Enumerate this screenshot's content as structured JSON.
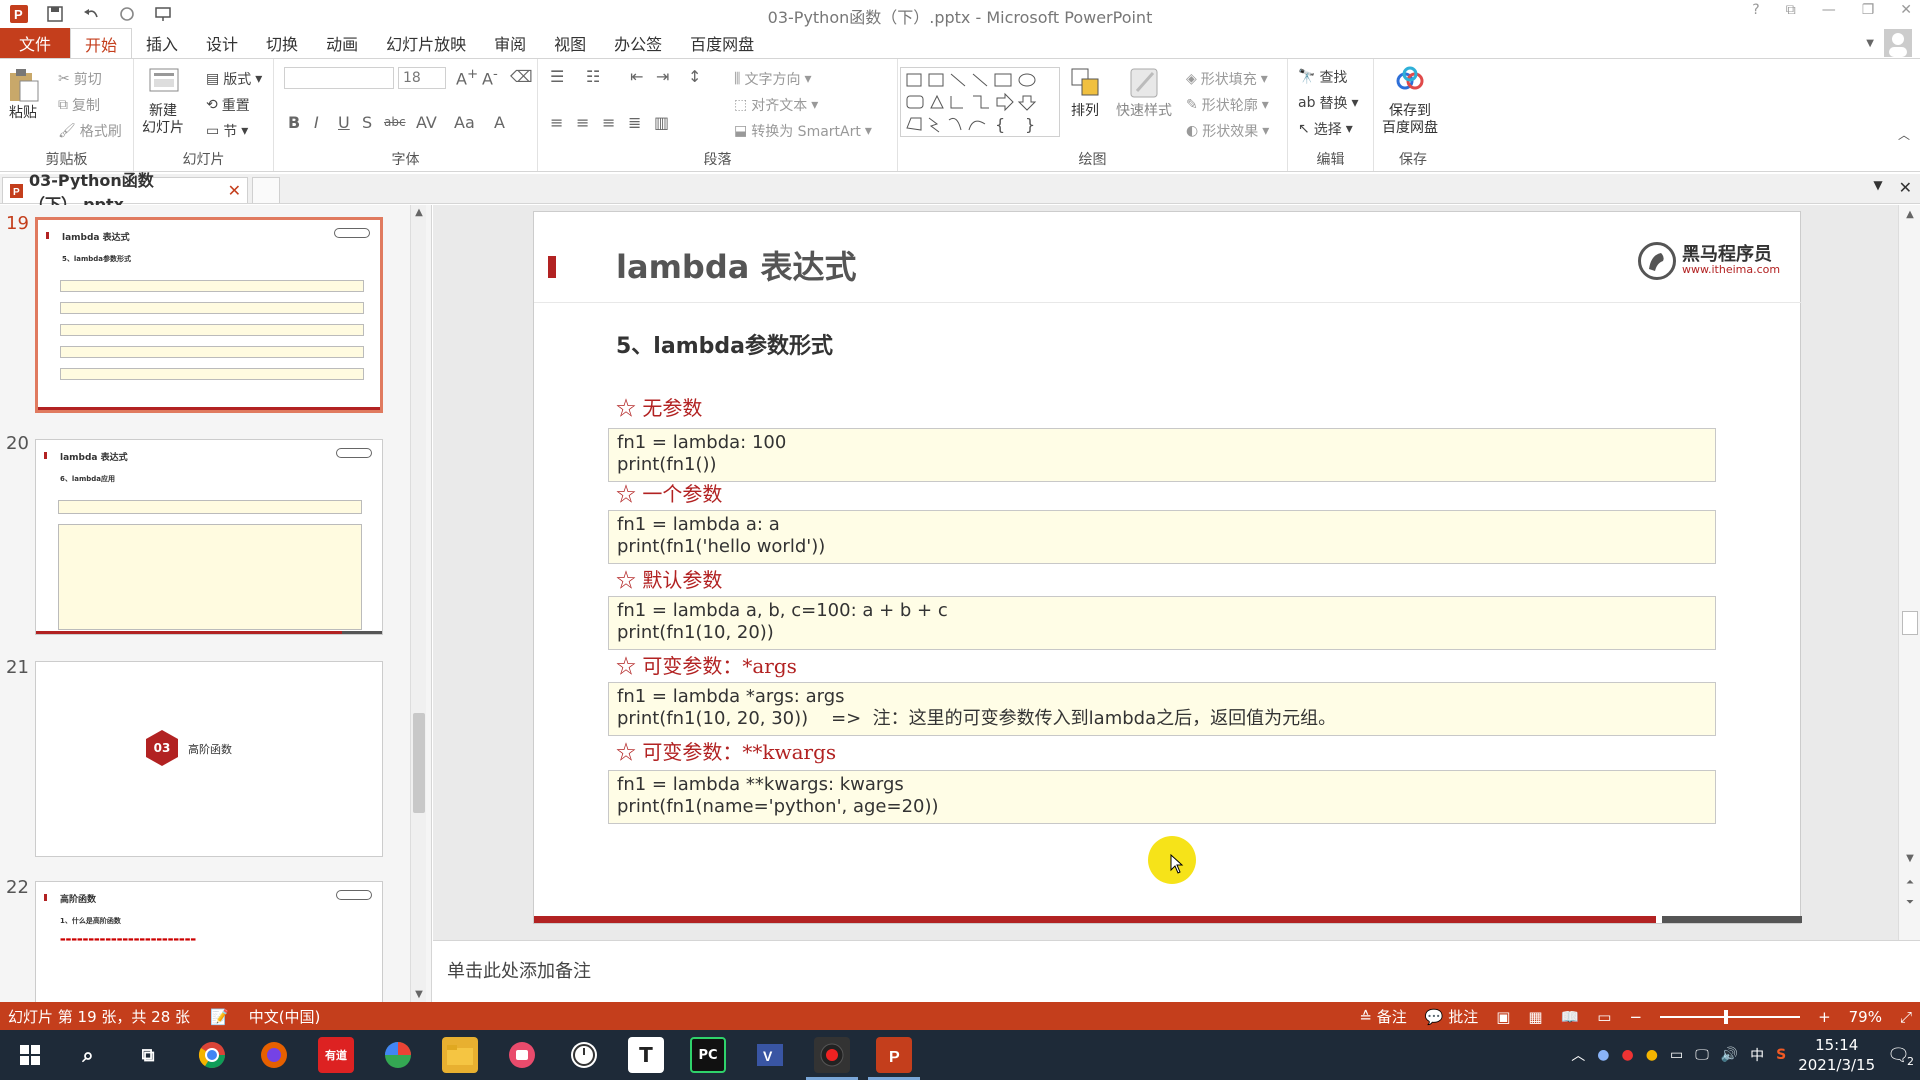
{
  "window": {
    "title": "03-Python函数（下）.pptx - Microsoft PowerPoint",
    "controls": [
      "?",
      "⧉",
      "—",
      "❐",
      "✕"
    ]
  },
  "ribbon_tabs": [
    "文件",
    "开始",
    "插入",
    "设计",
    "切换",
    "动画",
    "幻灯片放映",
    "审阅",
    "视图",
    "办公签",
    "百度网盘"
  ],
  "ribbon": {
    "clipboard": {
      "paste": "粘贴",
      "cut": "剪切",
      "copy": "复制",
      "format_painter": "格式刷",
      "label": "剪贴板"
    },
    "slides": {
      "new_slide": "新建\n幻灯片",
      "layout": "版式",
      "reset": "重置",
      "section": "节",
      "label": "幻灯片"
    },
    "font": {
      "size": "18",
      "label": "字体",
      "buttons": [
        "B",
        "I",
        "U",
        "S",
        "abc",
        "AV",
        "Aa",
        "A"
      ]
    },
    "paragraph": {
      "text_direction": "文字方向",
      "align_text": "对齐文本",
      "smartart": "转换为 SmartArt",
      "label": "段落"
    },
    "drawing": {
      "arrange": "排列",
      "quick_styles": "快速样式",
      "shape_fill": "形状填充",
      "shape_outline": "形状轮廓",
      "shape_effects": "形状效果",
      "label": "绘图"
    },
    "editing": {
      "find": "查找",
      "replace": "替换",
      "select": "选择",
      "label": "编辑"
    },
    "save": {
      "button": "保存到\n百度网盘",
      "label": "保存"
    }
  },
  "doc_tab": {
    "name": "03-Python函数（下）.pptx"
  },
  "thumbnails": [
    {
      "num": "19",
      "title": "lambda 表达式",
      "subtitle": "5、lambda参数形式"
    },
    {
      "num": "20",
      "title": "lambda 表达式",
      "subtitle": "6、lambda应用"
    },
    {
      "num": "21",
      "badge": "03",
      "section_title": "高阶函数"
    },
    {
      "num": "22",
      "title": "高阶函数",
      "subtitle": "1、什么是高阶函数"
    }
  ],
  "slide": {
    "title": "lambda 表达式",
    "logo_main": "黑马程序员",
    "logo_sub": "www.itheima.com",
    "subtitle": "5、lambda参数形式",
    "sections": [
      {
        "head": "☆ 无参数",
        "code": [
          "fn1 = lambda: 100",
          "print(fn1())"
        ]
      },
      {
        "head": "☆ 一个参数",
        "code": [
          "fn1 = lambda a: a",
          "print(fn1('hello world'))"
        ]
      },
      {
        "head": "☆ 默认参数",
        "code": [
          "fn1 = lambda a, b, c=100: a + b + c",
          "print(fn1(10, 20))"
        ]
      },
      {
        "head": "☆ 可变参数：*args",
        "code": [
          "fn1 = lambda *args: args",
          "print(fn1(10, 20, 30))    =>  注：这里的可变参数传入到lambda之后，返回值为元组。"
        ]
      },
      {
        "head": "☆ 可变参数：**kwargs",
        "code": [
          "fn1 = lambda **kwargs: kwargs",
          "print(fn1(name='python', age=20))"
        ]
      }
    ]
  },
  "notes": {
    "placeholder": "单击此处添加备注"
  },
  "status": {
    "slide_info": "幻灯片 第 19 张，共 28 张",
    "language": "中文(中国)",
    "notes_btn": "备注",
    "comments_btn": "批注",
    "zoom": "79%"
  },
  "taskbar": {
    "time": "15:14",
    "date": "2021/3/15",
    "ime": "中",
    "notification_count": "2"
  },
  "colors": {
    "accent": "#c43e1c",
    "slide_red": "#b22222",
    "code_bg": "#fffde6",
    "taskbar": "#1e2a38"
  }
}
